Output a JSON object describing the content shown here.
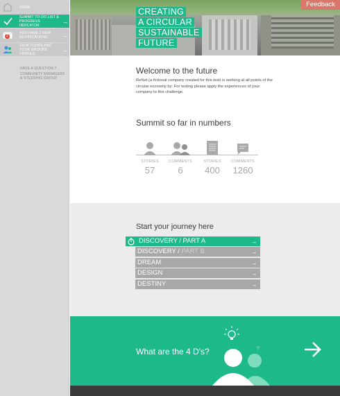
{
  "sidebar": {
    "items": [
      {
        "label": "HOME",
        "icon": "home-icon"
      },
      {
        "label": "SUMMIT TO DO LIST & PROGRESS INDICATOR",
        "icon": "check-icon"
      },
      {
        "label": "YOU HAVE 2 NEW NOTIFICATIONS",
        "icon": "envelope-icon",
        "badge": "2"
      },
      {
        "label": "VIEW YOURS AND YOUR GROUPS PROFILE",
        "icon": "group-icon"
      }
    ],
    "question": "HAVE A QUESTION ?",
    "community": "COMMUNITY MANAGERS & STEERING GROUP"
  },
  "hero": {
    "title_lines": [
      "CREATING",
      "A CIRCULAR",
      "SUSTAINABLE",
      "FUTURE"
    ],
    "feedback": "Feedback"
  },
  "welcome": {
    "title": "Welcome to the future",
    "text": "ReNet (a fictional company created for this test) is working at all points of the circular economy by: For testing please apply the experiences of your company to this challenge."
  },
  "numbers": {
    "title": "Summit so far in numbers",
    "stats": [
      {
        "label": "STORIES",
        "value": "57",
        "icon": "person-icon"
      },
      {
        "label": "COMMENTS",
        "value": "6",
        "icon": "people-icon"
      },
      {
        "label": "STORIES",
        "value": "400",
        "icon": "document-icon"
      },
      {
        "label": "COMMENTS",
        "value": "1260",
        "icon": "comment-icon"
      }
    ]
  },
  "journey": {
    "title": "Start your journey here",
    "items": [
      {
        "label": "DISCOVERY / PART A",
        "dim": ""
      },
      {
        "label": "DISCOVERY / ",
        "dim": "PART B"
      },
      {
        "label": "DREAM",
        "dim": ""
      },
      {
        "label": "DESIGN",
        "dim": ""
      },
      {
        "label": "DESTINY",
        "dim": ""
      }
    ]
  },
  "fourd": {
    "label": "What are the 4 D's?"
  },
  "colors": {
    "accent": "#1eb98a",
    "sidebar": "#d9d9d9",
    "feedback": "#d8776a",
    "journey_item": "#a8a8a8",
    "footer": "#3a3a3a"
  }
}
